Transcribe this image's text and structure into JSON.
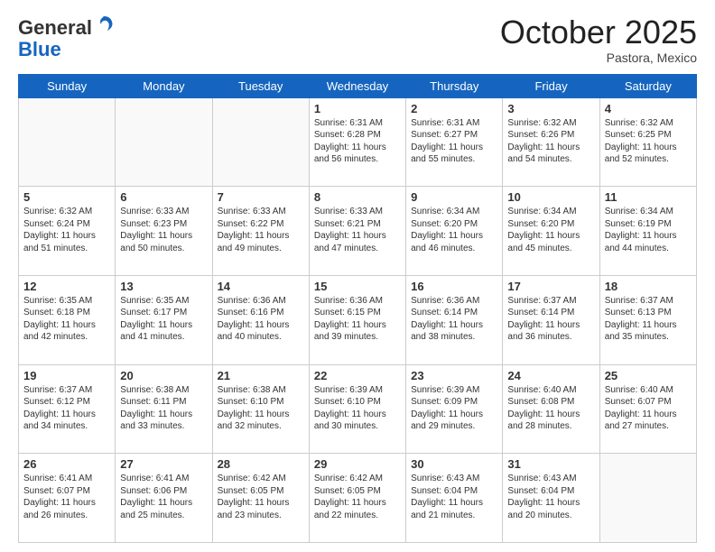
{
  "header": {
    "logo_general": "General",
    "logo_blue": "Blue",
    "month": "October 2025",
    "location": "Pastora, Mexico"
  },
  "weekdays": [
    "Sunday",
    "Monday",
    "Tuesday",
    "Wednesday",
    "Thursday",
    "Friday",
    "Saturday"
  ],
  "weeks": [
    [
      {
        "day": "",
        "text": ""
      },
      {
        "day": "",
        "text": ""
      },
      {
        "day": "",
        "text": ""
      },
      {
        "day": "1",
        "text": "Sunrise: 6:31 AM\nSunset: 6:28 PM\nDaylight: 11 hours and 56 minutes."
      },
      {
        "day": "2",
        "text": "Sunrise: 6:31 AM\nSunset: 6:27 PM\nDaylight: 11 hours and 55 minutes."
      },
      {
        "day": "3",
        "text": "Sunrise: 6:32 AM\nSunset: 6:26 PM\nDaylight: 11 hours and 54 minutes."
      },
      {
        "day": "4",
        "text": "Sunrise: 6:32 AM\nSunset: 6:25 PM\nDaylight: 11 hours and 52 minutes."
      }
    ],
    [
      {
        "day": "5",
        "text": "Sunrise: 6:32 AM\nSunset: 6:24 PM\nDaylight: 11 hours and 51 minutes."
      },
      {
        "day": "6",
        "text": "Sunrise: 6:33 AM\nSunset: 6:23 PM\nDaylight: 11 hours and 50 minutes."
      },
      {
        "day": "7",
        "text": "Sunrise: 6:33 AM\nSunset: 6:22 PM\nDaylight: 11 hours and 49 minutes."
      },
      {
        "day": "8",
        "text": "Sunrise: 6:33 AM\nSunset: 6:21 PM\nDaylight: 11 hours and 47 minutes."
      },
      {
        "day": "9",
        "text": "Sunrise: 6:34 AM\nSunset: 6:20 PM\nDaylight: 11 hours and 46 minutes."
      },
      {
        "day": "10",
        "text": "Sunrise: 6:34 AM\nSunset: 6:20 PM\nDaylight: 11 hours and 45 minutes."
      },
      {
        "day": "11",
        "text": "Sunrise: 6:34 AM\nSunset: 6:19 PM\nDaylight: 11 hours and 44 minutes."
      }
    ],
    [
      {
        "day": "12",
        "text": "Sunrise: 6:35 AM\nSunset: 6:18 PM\nDaylight: 11 hours and 42 minutes."
      },
      {
        "day": "13",
        "text": "Sunrise: 6:35 AM\nSunset: 6:17 PM\nDaylight: 11 hours and 41 minutes."
      },
      {
        "day": "14",
        "text": "Sunrise: 6:36 AM\nSunset: 6:16 PM\nDaylight: 11 hours and 40 minutes."
      },
      {
        "day": "15",
        "text": "Sunrise: 6:36 AM\nSunset: 6:15 PM\nDaylight: 11 hours and 39 minutes."
      },
      {
        "day": "16",
        "text": "Sunrise: 6:36 AM\nSunset: 6:14 PM\nDaylight: 11 hours and 38 minutes."
      },
      {
        "day": "17",
        "text": "Sunrise: 6:37 AM\nSunset: 6:14 PM\nDaylight: 11 hours and 36 minutes."
      },
      {
        "day": "18",
        "text": "Sunrise: 6:37 AM\nSunset: 6:13 PM\nDaylight: 11 hours and 35 minutes."
      }
    ],
    [
      {
        "day": "19",
        "text": "Sunrise: 6:37 AM\nSunset: 6:12 PM\nDaylight: 11 hours and 34 minutes."
      },
      {
        "day": "20",
        "text": "Sunrise: 6:38 AM\nSunset: 6:11 PM\nDaylight: 11 hours and 33 minutes."
      },
      {
        "day": "21",
        "text": "Sunrise: 6:38 AM\nSunset: 6:10 PM\nDaylight: 11 hours and 32 minutes."
      },
      {
        "day": "22",
        "text": "Sunrise: 6:39 AM\nSunset: 6:10 PM\nDaylight: 11 hours and 30 minutes."
      },
      {
        "day": "23",
        "text": "Sunrise: 6:39 AM\nSunset: 6:09 PM\nDaylight: 11 hours and 29 minutes."
      },
      {
        "day": "24",
        "text": "Sunrise: 6:40 AM\nSunset: 6:08 PM\nDaylight: 11 hours and 28 minutes."
      },
      {
        "day": "25",
        "text": "Sunrise: 6:40 AM\nSunset: 6:07 PM\nDaylight: 11 hours and 27 minutes."
      }
    ],
    [
      {
        "day": "26",
        "text": "Sunrise: 6:41 AM\nSunset: 6:07 PM\nDaylight: 11 hours and 26 minutes."
      },
      {
        "day": "27",
        "text": "Sunrise: 6:41 AM\nSunset: 6:06 PM\nDaylight: 11 hours and 25 minutes."
      },
      {
        "day": "28",
        "text": "Sunrise: 6:42 AM\nSunset: 6:05 PM\nDaylight: 11 hours and 23 minutes."
      },
      {
        "day": "29",
        "text": "Sunrise: 6:42 AM\nSunset: 6:05 PM\nDaylight: 11 hours and 22 minutes."
      },
      {
        "day": "30",
        "text": "Sunrise: 6:43 AM\nSunset: 6:04 PM\nDaylight: 11 hours and 21 minutes."
      },
      {
        "day": "31",
        "text": "Sunrise: 6:43 AM\nSunset: 6:04 PM\nDaylight: 11 hours and 20 minutes."
      },
      {
        "day": "",
        "text": ""
      }
    ]
  ]
}
